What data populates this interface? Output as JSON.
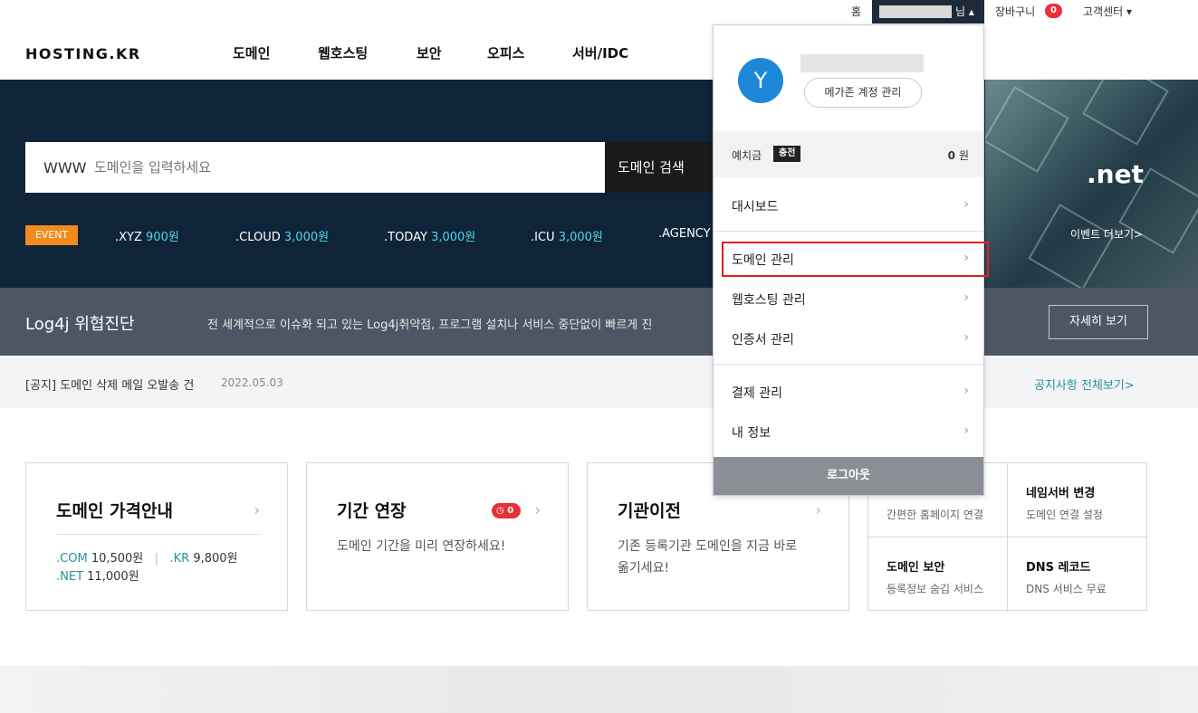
{
  "util": {
    "home": "홈",
    "nim": "님 ▴",
    "cart": "장바구니",
    "cart_count": "0",
    "customer_center": "고객센터 ▾"
  },
  "header": {
    "logo": "HOSTING.KR",
    "nav": [
      "도메인",
      "웹호스팅",
      "보안",
      "오피스",
      "서버/IDC"
    ]
  },
  "hero": {
    "search_prefix": "WWW",
    "search_placeholder": "도메인을 입력하세요",
    "search_button": "도메인 검색",
    "event_badge": "EVENT",
    "extensions": [
      {
        "name": ".XYZ",
        "price": "900원"
      },
      {
        "name": ".CLOUD",
        "price": "3,000원"
      },
      {
        "name": ".TODAY",
        "price": "3,000원"
      },
      {
        "name": ".ICU",
        "price": "3,000원"
      },
      {
        "name": ".AGENCY",
        "price": ""
      }
    ],
    "banner_text": ".net",
    "event_more": "이벤트 더보기>"
  },
  "log4j": {
    "title": "Log4j 위협진단",
    "desc": "전 세계적으로 이슈화 되고 있는 Log4j취약점, 프로그램 설치나 서비스 중단없이 빠르게 진",
    "button": "자세히 보기"
  },
  "notice": {
    "text": "[공지] 도메인 삭제 메일 오발송 건",
    "date": "2022.05.03",
    "all": "공지사항 전체보기>"
  },
  "cards": {
    "price": {
      "title": "도메인 가격안내",
      "com_label": ".COM",
      "com_price": "10,500원",
      "sep": "|",
      "kr_label": ".KR",
      "kr_price": "9,800원",
      "net_label": ".NET",
      "net_price": "11,000원"
    },
    "renew": {
      "title": "기간 연장",
      "count": "0",
      "desc": "도메인 기간을 미리 연장하세요!"
    },
    "transfer": {
      "title": "기관이전",
      "desc1": "기존 등록기관 도메인을 지금 바로",
      "desc2": "옮기세요!"
    },
    "grid": [
      {
        "title": "",
        "desc": "간편한 홈페이지 연결"
      },
      {
        "title": "네임서버 변경",
        "desc": "도메인 연결 설정"
      },
      {
        "title": "도메인 보안",
        "desc": "등록정보 숨김 서비스"
      },
      {
        "title": "DNS 레코드",
        "desc": "DNS 서비스 무료"
      }
    ]
  },
  "dropdown": {
    "avatar_letter": "Y",
    "account_button": "메가존 계정 관리",
    "deposit_label": "예치금",
    "charge_label": "충전",
    "deposit_amount": "0",
    "deposit_unit": "원",
    "menu": [
      "대시보드",
      "도메인 관리",
      "웹호스팅 관리",
      "인증서 관리",
      "결제 관리",
      "내 정보"
    ],
    "logout": "로그아웃"
  },
  "colors": {
    "accent": "#2a8f9a",
    "highlight": "#e02020",
    "hero_bg": "#0f2438",
    "badge": "#e6303a"
  }
}
